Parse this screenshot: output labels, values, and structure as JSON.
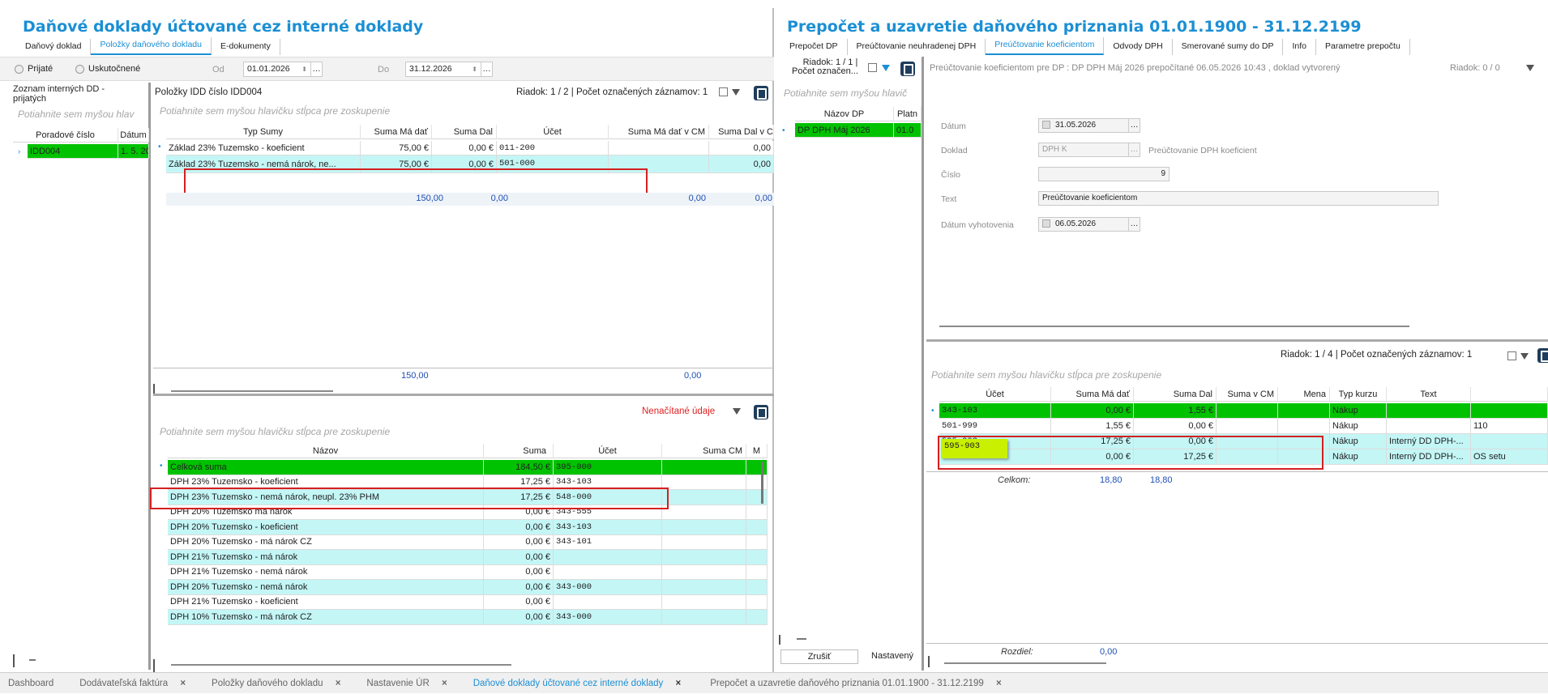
{
  "left": {
    "title": "Daňové doklady účtované cez interné doklady",
    "tabs": [
      "Daňový doklad",
      "Položky daňového dokladu",
      "E-dokumenty"
    ],
    "radio_received": "Prijaté",
    "radio_realized": "Uskutočnené",
    "from_label": "Od",
    "from_date": "01.01.2026",
    "to_label": "Do",
    "to_date": "31.12.2026",
    "list_title": "Zoznam interných DD - prijatých",
    "group_hint": "Potiahnite sem myšou hlavičku stĺpca pre zoskupenie",
    "group_hint_short": "Potiahnite sem myšou hlav",
    "list_cols": [
      "Poradové číslo",
      "Dátum"
    ],
    "list_rows": [
      [
        "IDD004",
        "1. 5. 20"
      ]
    ],
    "items_title": "Položky IDD číslo IDD004",
    "items_status": "Riadok: 1 / 2 | Počet označených záznamov: 1",
    "items_cols": [
      "Typ Sumy",
      "Suma Má dať",
      "Suma Dal",
      "Účet",
      "Suma Má dať v CM",
      "Suma Dal v C"
    ],
    "items_rows": [
      [
        "Základ 23% Tuzemsko - koeficient",
        "75,00 €",
        "0,00 €",
        "011-200",
        "",
        "0,00"
      ],
      [
        "Základ 23% Tuzemsko - nemá nárok, ne...",
        "75,00 €",
        "0,00 €",
        "501-000",
        "",
        "0,00"
      ]
    ],
    "items_subtotal": [
      "150,00",
      "0,00",
      "0,00",
      "0,00"
    ],
    "items_total": [
      "150,00",
      "0,00"
    ],
    "vat_status": "Nenačítané údaje",
    "vat_cols": [
      "Názov",
      "Suma",
      "Účet",
      "Suma CM",
      "M"
    ],
    "vat_rows": [
      [
        "Celková suma",
        "184,50 €",
        "395-000"
      ],
      [
        "DPH 23% Tuzemsko - koeficient",
        "17,25 €",
        "343-103"
      ],
      [
        "DPH 23% Tuzemsko - nemá nárok, neupl. 23% PHM",
        "17,25 €",
        "548-000"
      ],
      [
        "DPH 20% Tuzemsko má nárok",
        "0,00 €",
        "343-555"
      ],
      [
        "DPH 20% Tuzemsko - koeficient",
        "0,00 €",
        "343-103"
      ],
      [
        "DPH 20% Tuzemsko - má nárok CZ",
        "0,00 €",
        "343-101"
      ],
      [
        "DPH 21% Tuzemsko - má nárok",
        "0,00 €",
        ""
      ],
      [
        "DPH 21% Tuzemsko - nemá nárok",
        "0,00 €",
        ""
      ],
      [
        "DPH 20% Tuzemsko - nemá nárok",
        "0,00 €",
        "343-000"
      ],
      [
        "DPH 21% Tuzemsko - koeficient",
        "0,00 €",
        ""
      ],
      [
        "DPH 10% Tuzemsko - má nárok CZ",
        "0,00 €",
        "343-000"
      ]
    ]
  },
  "right": {
    "title": "Prepočet a uzavretie daňového priznania 01.01.1900 - 31.12.2199",
    "tabs": [
      "Prepočet DP",
      "Preúčtovanie neuhradenej DPH",
      "Preúčtovanie koeficientom",
      "Odvody DPH",
      "Smerované sumy do DP",
      "Info",
      "Parametre prepočtu"
    ],
    "list_status_1": "Riadok: 1 / 1 |",
    "list_status_2": "Počet označen...",
    "group_hint_short": "Potiahnite sem myšou hlavič",
    "list_cols": [
      "Názov DP",
      "Platn"
    ],
    "list_rows": [
      [
        "DP DPH Máj 2026",
        "01.0"
      ]
    ],
    "doc_header": "Preúčtovanie koeficientom pre DP : DP DPH Máj 2026 prepočítané 06.05.2026 10:43 , doklad vytvorený",
    "doc_status": "Riadok: 0 / 0",
    "form": {
      "date_label": "Dátum",
      "date_value": "31.05.2026",
      "doc_label": "Doklad",
      "doc_value": "DPH K",
      "doc_desc": "Preúčtovanie DPH koeficient",
      "num_label": "Číslo",
      "num_value": "9",
      "text_label": "Text",
      "text_value": "Preúčtovanie koeficientom",
      "created_label": "Dátum vyhotovenia",
      "created_value": "06.05.2026"
    },
    "grid_status": "Riadok: 1 / 4 | Počet označených záznamov: 1",
    "group_hint": "Potiahnite sem myšou hlavičku stĺpca pre zoskupenie",
    "grid_cols": [
      "Účet",
      "Suma Má dať",
      "Suma Dal",
      "Suma v CM",
      "Mena",
      "Typ kurzu",
      "Text",
      ""
    ],
    "grid_rows": [
      [
        "343-103",
        "0,00 €",
        "1,55 €",
        "",
        "",
        "Nákup",
        "",
        ""
      ],
      [
        "501-999",
        "1,55 €",
        "0,00 €",
        "",
        "",
        "Nákup",
        "",
        "110"
      ],
      [
        "595-903",
        "17,25 €",
        "0,00 €",
        "",
        "",
        "Nákup",
        "Interný DD DPH-...",
        ""
      ],
      [
        "548-000",
        "0,00 €",
        "17,25 €",
        "",
        "",
        "Nákup",
        "Interný DD DPH-...",
        "OS setu"
      ]
    ],
    "total_label": "Celkom:",
    "total_debit": "18,80",
    "total_credit": "18,80",
    "diff_label": "Rozdiel:",
    "diff_value": "0,00",
    "cancel_button": "Zrušiť",
    "settings_label": "Nastavený"
  },
  "bottom_tabs": [
    "Dashboard",
    "Dodávateľská faktúra",
    "Položky daňového dokladu",
    "Nastavenie ÚR",
    "Daňové doklady účtované cez interné doklady",
    "Prepočet a uzavretie daňového priznania 01.01.1900 - 31.12.2199"
  ],
  "colors": {
    "accent": "#1b8fd4",
    "selected_row": "#00c200",
    "alt_row": "#c4f6f6",
    "highlight_box": "#d42020"
  }
}
